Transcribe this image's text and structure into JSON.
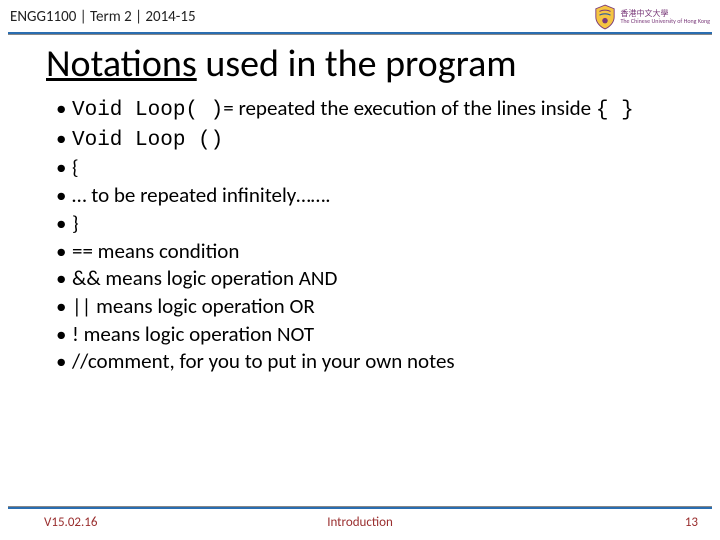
{
  "header": {
    "course": "ENGG1100 | Term 2 | 2014-15",
    "logo": {
      "cn": "香港中文大學",
      "en": "The Chinese University of Hong Kong"
    }
  },
  "title": {
    "underlined": "Notations",
    "rest": " used in the program"
  },
  "bullets": {
    "b1_code": "Void Loop( )",
    "b1_rest": "= repeated the execution of the lines inside",
    "b1_braces": "{ }",
    "b2": "Void Loop ()",
    "b3": "{",
    "b4": "… to be repeated infinitely…….",
    "b5": "}",
    "b6": "== means condition",
    "b7": "&& means logic operation AND",
    "b8": "|| means logic operation OR",
    "b9": "! means logic operation NOT",
    "b10": "//comment, for you to put in your own notes"
  },
  "footer": {
    "version": "V15.02.16",
    "center": "Introduction",
    "page": "13"
  }
}
